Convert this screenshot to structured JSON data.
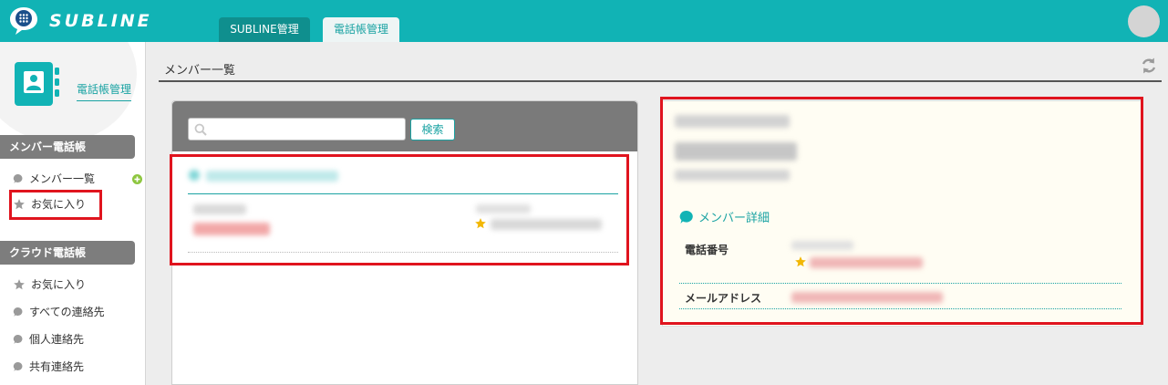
{
  "app": {
    "name": "SUBLINE"
  },
  "tabs": [
    {
      "label": "SUBLINE管理"
    },
    {
      "label": "電話帳管理"
    }
  ],
  "sidebar": {
    "title": "電話帳管理",
    "sections": [
      {
        "heading": "メンバー電話帳",
        "items": [
          {
            "label": "メンバー一覧",
            "icon": "speech-bubble-icon"
          },
          {
            "label": "お気に入り",
            "icon": "star-icon"
          }
        ]
      },
      {
        "heading": "クラウド電話帳",
        "items": [
          {
            "label": "お気に入り",
            "icon": "star-icon"
          },
          {
            "label": "すべての連絡先",
            "icon": "speech-bubble-icon"
          },
          {
            "label": "個人連絡先",
            "icon": "speech-bubble-icon"
          },
          {
            "label": "共有連絡先",
            "icon": "speech-bubble-icon"
          }
        ]
      }
    ]
  },
  "main": {
    "page_title": "メンバー一覧",
    "search": {
      "placeholder": "",
      "value": "",
      "button_label": "検索"
    },
    "detail": {
      "section_title": "メンバー詳細",
      "fields": [
        {
          "label": "電話番号"
        },
        {
          "label": "メールアドレス"
        }
      ]
    }
  },
  "colors": {
    "brand": "#11b3b5",
    "highlight": "#e0141e",
    "favorite_star": "#f2b705",
    "detail_background": "#fffdf3"
  }
}
